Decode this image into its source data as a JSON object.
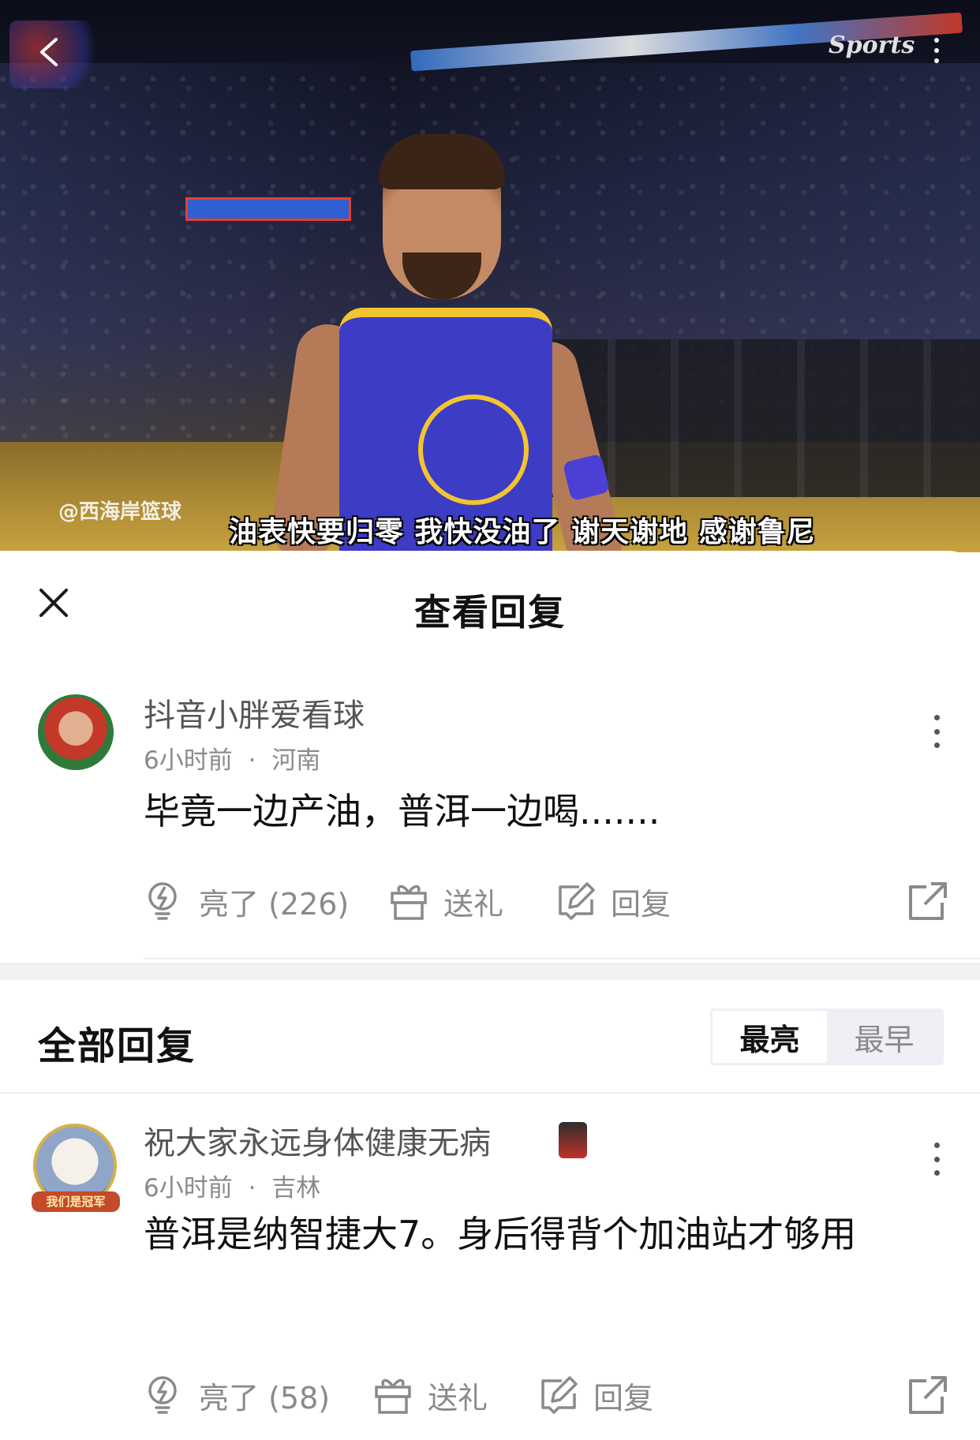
{
  "video": {
    "subtitle": "油表快要归零 我快没油了 谢天谢地 感谢鲁尼",
    "watermark": "@西海岸篮球",
    "brand": "Sports",
    "icons": {
      "back": "chevron-left-icon",
      "more": "more-vertical-icon"
    }
  },
  "sheet": {
    "close_icon": "close-icon",
    "title": "查看回复"
  },
  "main_comment": {
    "username": "抖音小胖爱看球",
    "time": "6小时前",
    "separator": "·",
    "location": "河南",
    "text": "毕竟一边产油，普洱一边喝.......",
    "like_label": "亮了 (226)",
    "gift_label": "送礼",
    "reply_label": "回复"
  },
  "replies_section": {
    "title": "全部回复",
    "sort_options": [
      "最亮",
      "最早"
    ],
    "active_sort": "最亮"
  },
  "replies": [
    {
      "username": "祝大家永远身体健康无病",
      "avatar_badge": "我们是冠军",
      "time": "6小时前",
      "separator": "·",
      "location": "吉林",
      "text": "普洱是纳智捷大7。身后得背个加油站才够用",
      "like_label": "亮了 (58)",
      "gift_label": "送礼",
      "reply_label": "回复"
    }
  ],
  "colors": {
    "text_primary": "#111111",
    "text_secondary": "#8a8a8a",
    "username": "#555555",
    "divider": "#f2f2f2"
  }
}
